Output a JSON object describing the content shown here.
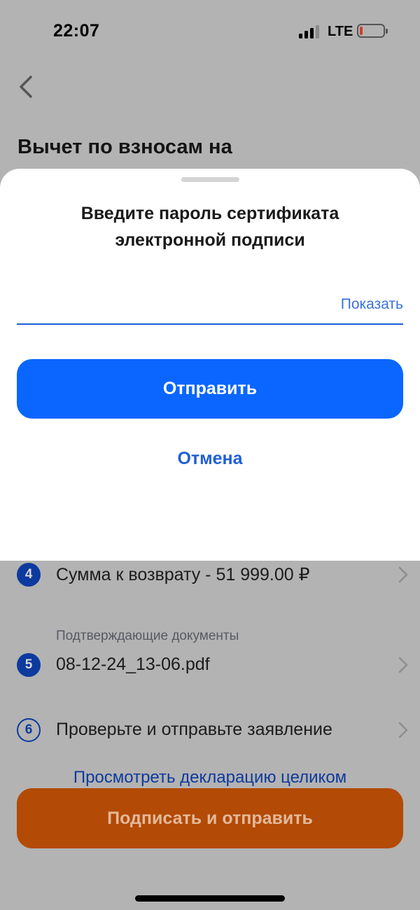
{
  "status_bar": {
    "time": "22:07",
    "network": "LTE",
    "signal_level": "3 of 4 bars",
    "battery_icon": "battery-low-icon"
  },
  "header": {
    "back_icon": "chevron-left-icon",
    "title": "Вычет по взносам на"
  },
  "steps": [
    {
      "number": "4",
      "text": "Сумма к возврату - 51 999.00 ₽",
      "completed": true
    },
    {
      "number": "5",
      "caption": "Подтверждающие документы",
      "text": "08-12-24_13-06.pdf",
      "completed": true
    },
    {
      "number": "6",
      "text": "Проверьте и отправьте заявление",
      "completed": false
    }
  ],
  "view_link": "Просмотреть декларацию целиком",
  "sign_button": "Подписать и отправить",
  "sheet": {
    "title_line1": "Введите пароль сертификата",
    "title_line2": "электронной подписи",
    "password_value": "",
    "show_label": "Показать",
    "submit_label": "Отправить",
    "cancel_label": "Отмена"
  },
  "colors": {
    "primary_blue": "#0a66ff",
    "sign_orange": "#b34a06",
    "step_badge": "#0c3a9e"
  }
}
